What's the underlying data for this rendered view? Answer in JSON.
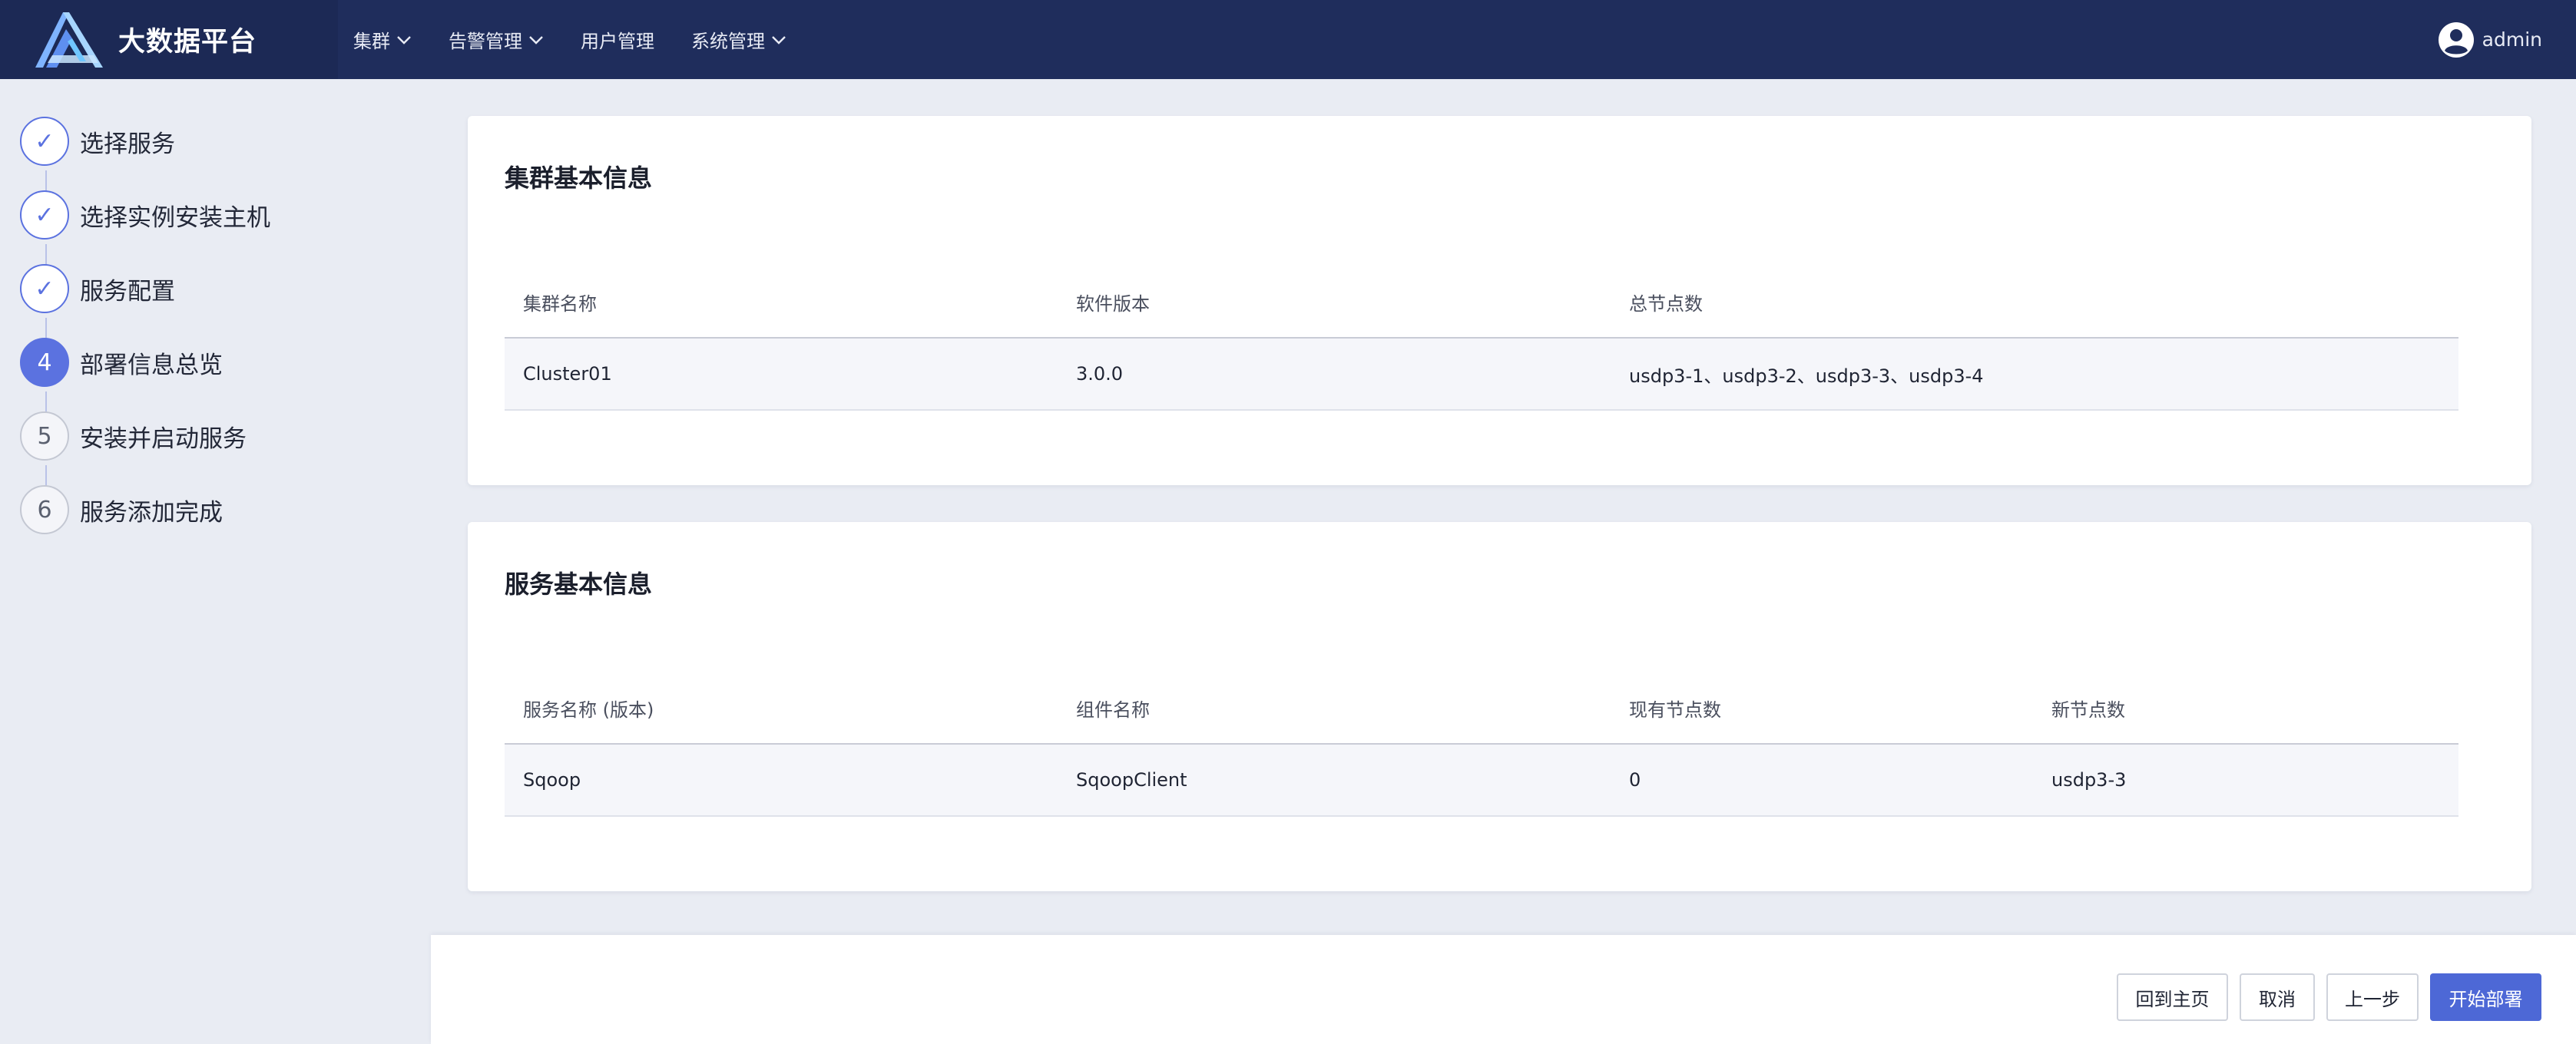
{
  "app": {
    "title": "大数据平台"
  },
  "nav": {
    "items": [
      {
        "label": "集群",
        "has_dropdown": true
      },
      {
        "label": "告警管理",
        "has_dropdown": true
      },
      {
        "label": "用户管理",
        "has_dropdown": false
      },
      {
        "label": "系统管理",
        "has_dropdown": true
      }
    ]
  },
  "user": {
    "name": "admin",
    "icon": "user-avatar-icon"
  },
  "steps": [
    {
      "marker": "✓",
      "label": "选择服务",
      "state": "done"
    },
    {
      "marker": "✓",
      "label": "选择实例安装主机",
      "state": "done"
    },
    {
      "marker": "✓",
      "label": "服务配置",
      "state": "done"
    },
    {
      "marker": "4",
      "label": "部署信息总览",
      "state": "active"
    },
    {
      "marker": "5",
      "label": "安装并启动服务",
      "state": "todo"
    },
    {
      "marker": "6",
      "label": "服务添加完成",
      "state": "todo"
    }
  ],
  "cluster_info": {
    "title": "集群基本信息",
    "headers": [
      "集群名称",
      "软件版本",
      "总节点数"
    ],
    "rows": [
      [
        "Cluster01",
        "3.0.0",
        "usdp3-1、usdp3-2、usdp3-3、usdp3-4"
      ]
    ]
  },
  "service_info": {
    "title": "服务基本信息",
    "headers": [
      "服务名称 (版本)",
      "组件名称",
      "现有节点数",
      "新节点数"
    ],
    "rows": [
      [
        "Sqoop",
        "SqoopClient",
        "0",
        "usdp3-3"
      ]
    ]
  },
  "footer": {
    "home_label": "回到主页",
    "cancel_label": "取消",
    "prev_label": "上一步",
    "deploy_label": "开始部署"
  },
  "colors": {
    "header_bg": "#1f2d5c",
    "accent": "#5b72e0",
    "primary_button": "#4d68d6",
    "page_bg": "#e9ecf3"
  }
}
